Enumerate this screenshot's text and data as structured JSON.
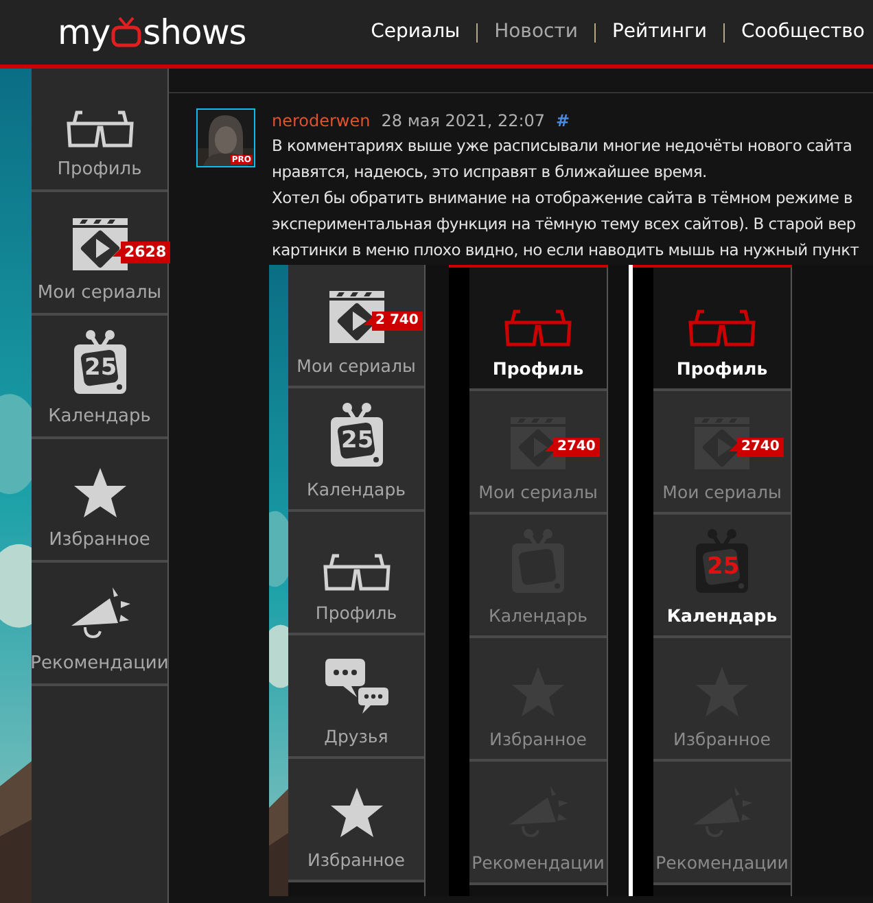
{
  "header": {
    "logo": {
      "left": "my",
      "right": "shows"
    },
    "nav": [
      {
        "label": "Сериалы",
        "muted": false
      },
      {
        "label": "Новости",
        "muted": true
      },
      {
        "label": "Рейтинги",
        "muted": false
      },
      {
        "label": "Сообщество",
        "muted": false
      }
    ]
  },
  "sidebar": {
    "items": [
      {
        "label": "Профиль",
        "kind": "glasses"
      },
      {
        "label": "Мои сериалы",
        "kind": "clapper",
        "badge": "2628"
      },
      {
        "label": "Календарь",
        "kind": "tv",
        "icon_text": "25"
      },
      {
        "label": "Избранное",
        "kind": "star"
      },
      {
        "label": "Рекомендации",
        "kind": "megaphone"
      }
    ]
  },
  "comment": {
    "author": "neroderwen",
    "date": "28 мая 2021, 22:07",
    "anchor": "#",
    "avatar_badge": "PRO",
    "lines": [
      "В комментариях выше уже расписывали многие недочёты нового сайта",
      "нравятся, надеюсь, это исправят в ближайшее время.",
      "Хотел бы обратить внимание на отображение сайта в тёмном режиме в",
      "экспериментальная функция на тёмную тему всех сайтов). В старой вер",
      "картинки в меню плохо видно, но если наводить мышь на нужный пункт"
    ],
    "attachment": {
      "panels": [
        {
          "kind": "light",
          "items": [
            {
              "label": "Мои сериалы",
              "kind": "clapper",
              "badge": "2 740"
            },
            {
              "label": "Календарь",
              "kind": "tv",
              "icon_text": "25"
            },
            {
              "label": "Профиль",
              "kind": "glasses"
            },
            {
              "label": "Друзья",
              "kind": "chat"
            },
            {
              "label": "Избранное",
              "kind": "star"
            }
          ]
        },
        {
          "kind": "dim",
          "items": [
            {
              "label": "Профиль",
              "kind": "glasses",
              "active": true,
              "current": true
            },
            {
              "label": "Мои сериалы",
              "kind": "clapper",
              "badge": "2740",
              "active": false,
              "current": false
            },
            {
              "label": "Календарь",
              "kind": "tv",
              "active": false,
              "current": false
            },
            {
              "label": "Избранное",
              "kind": "star",
              "active": false,
              "current": false
            },
            {
              "label": "Рекомендации",
              "kind": "megaphone",
              "active": false,
              "current": false
            }
          ]
        },
        {
          "kind": "dim",
          "items": [
            {
              "label": "Профиль",
              "kind": "glasses",
              "active": true,
              "current": true
            },
            {
              "label": "Мои сериалы",
              "kind": "clapper",
              "badge": "2740",
              "active": false,
              "current": false
            },
            {
              "label": "Календарь",
              "kind": "tv",
              "icon_text": "25",
              "active": true,
              "current": false
            },
            {
              "label": "Избранное",
              "kind": "star",
              "active": false,
              "current": false
            },
            {
              "label": "Рекомендации",
              "kind": "megaphone",
              "active": false,
              "current": false
            }
          ]
        }
      ]
    }
  }
}
